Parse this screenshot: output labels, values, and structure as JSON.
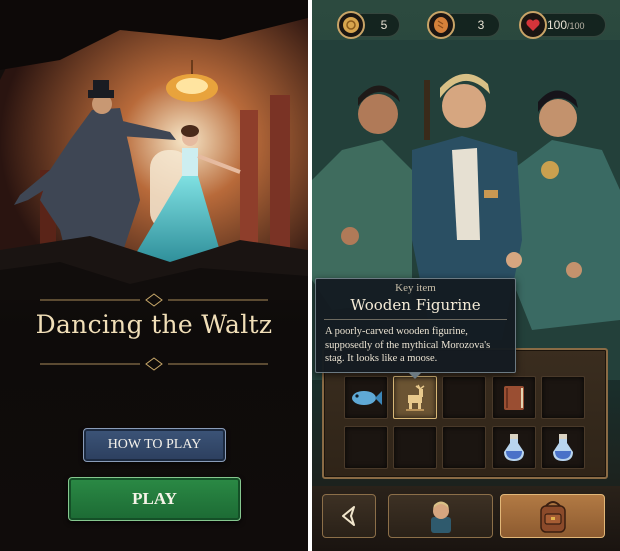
{
  "left_screen": {
    "title": "Dancing the Waltz",
    "how_to_play_label": "HOW TO PLAY",
    "play_label": "PLAY"
  },
  "right_screen": {
    "resources": [
      {
        "icon": "coin-icon",
        "value": "5"
      },
      {
        "icon": "bread-icon",
        "value": "3"
      },
      {
        "icon": "heart-icon",
        "value": "100",
        "max": "/100"
      }
    ],
    "tooltip": {
      "kicker": "Key item",
      "title": "Wooden Figurine",
      "description": "A poorly-carved wooden figurine, supposedly of the mythical Morozova's stag. It looks like a moose."
    },
    "inventory": {
      "rows": [
        [
          "fish-icon",
          "wooden-figurine-icon",
          "",
          "book-icon",
          ""
        ],
        [
          "",
          "",
          "",
          "potion-icon",
          "potion-icon"
        ]
      ],
      "selected": "wooden-figurine-icon"
    },
    "nav": [
      "back-arrow-icon",
      "character-portrait-icon",
      "backpack-icon"
    ]
  },
  "colors": {
    "title_text": "#f1dfb8",
    "how_to_play_bg": "#2c3f5e",
    "play_bg": "#1c6a34",
    "inventory_border": "#8a6b45",
    "selected_slot": "#6b5433"
  }
}
